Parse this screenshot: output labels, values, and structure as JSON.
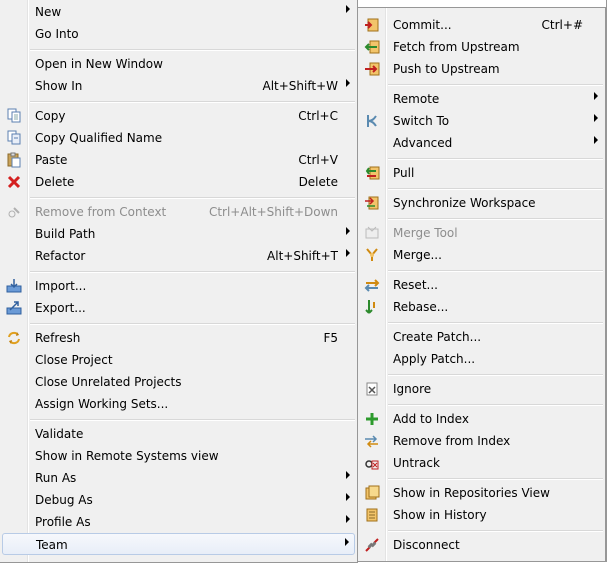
{
  "main_menu": {
    "items": [
      {
        "label": "New",
        "shortcut": "",
        "arrow": true,
        "icon": "",
        "disabled": false
      },
      {
        "label": "Go Into",
        "shortcut": "",
        "arrow": false,
        "icon": "",
        "disabled": false
      },
      {
        "label": "Open in New Window",
        "shortcut": "",
        "arrow": false,
        "icon": "",
        "disabled": false
      },
      {
        "label": "Show In",
        "shortcut": "Alt+Shift+W",
        "arrow": true,
        "icon": "",
        "disabled": false
      },
      {
        "label": "Copy",
        "shortcut": "Ctrl+C",
        "arrow": false,
        "icon": "copy-icon",
        "disabled": false
      },
      {
        "label": "Copy Qualified Name",
        "shortcut": "",
        "arrow": false,
        "icon": "copy-qualified-name-icon",
        "disabled": false
      },
      {
        "label": "Paste",
        "shortcut": "Ctrl+V",
        "arrow": false,
        "icon": "paste-icon",
        "disabled": false
      },
      {
        "label": "Delete",
        "shortcut": "Delete",
        "arrow": false,
        "icon": "delete-icon",
        "disabled": false
      },
      {
        "label": "Remove from Context",
        "shortcut": "Ctrl+Alt+Shift+Down",
        "arrow": false,
        "icon": "remove-from-context-icon",
        "disabled": true
      },
      {
        "label": "Build Path",
        "shortcut": "",
        "arrow": true,
        "icon": "",
        "disabled": false
      },
      {
        "label": "Refactor",
        "shortcut": "Alt+Shift+T",
        "arrow": true,
        "icon": "",
        "disabled": false
      },
      {
        "label": "Import...",
        "shortcut": "",
        "arrow": false,
        "icon": "import-icon",
        "disabled": false
      },
      {
        "label": "Export...",
        "shortcut": "",
        "arrow": false,
        "icon": "export-icon",
        "disabled": false
      },
      {
        "label": "Refresh",
        "shortcut": "F5",
        "arrow": false,
        "icon": "refresh-icon",
        "disabled": false
      },
      {
        "label": "Close Project",
        "shortcut": "",
        "arrow": false,
        "icon": "",
        "disabled": false
      },
      {
        "label": "Close Unrelated Projects",
        "shortcut": "",
        "arrow": false,
        "icon": "",
        "disabled": false
      },
      {
        "label": "Assign Working Sets...",
        "shortcut": "",
        "arrow": false,
        "icon": "",
        "disabled": false
      },
      {
        "label": "Validate",
        "shortcut": "",
        "arrow": false,
        "icon": "",
        "disabled": false
      },
      {
        "label": "Show in Remote Systems view",
        "shortcut": "",
        "arrow": false,
        "icon": "",
        "disabled": false
      },
      {
        "label": "Run As",
        "shortcut": "",
        "arrow": true,
        "icon": "",
        "disabled": false
      },
      {
        "label": "Debug As",
        "shortcut": "",
        "arrow": true,
        "icon": "",
        "disabled": false
      },
      {
        "label": "Profile As",
        "shortcut": "",
        "arrow": true,
        "icon": "",
        "disabled": false
      },
      {
        "label": "Team",
        "shortcut": "",
        "arrow": true,
        "icon": "",
        "disabled": false,
        "highlighted": true
      }
    ]
  },
  "team_menu": {
    "items": [
      {
        "label": "Commit...",
        "shortcut": "Ctrl+#",
        "arrow": false,
        "icon": "commit-icon",
        "disabled": false
      },
      {
        "label": "Fetch from Upstream",
        "shortcut": "",
        "arrow": false,
        "icon": "fetch-icon",
        "disabled": false
      },
      {
        "label": "Push to Upstream",
        "shortcut": "",
        "arrow": false,
        "icon": "push-icon",
        "disabled": false
      },
      {
        "label": "Remote",
        "shortcut": "",
        "arrow": true,
        "icon": "",
        "disabled": false
      },
      {
        "label": "Switch To",
        "shortcut": "",
        "arrow": true,
        "icon": "switch-branch-icon",
        "disabled": false
      },
      {
        "label": "Advanced",
        "shortcut": "",
        "arrow": true,
        "icon": "",
        "disabled": false
      },
      {
        "label": "Pull",
        "shortcut": "",
        "arrow": false,
        "icon": "pull-icon",
        "disabled": false
      },
      {
        "label": "Synchronize Workspace",
        "shortcut": "",
        "arrow": false,
        "icon": "synchronize-icon",
        "disabled": false
      },
      {
        "label": "Merge Tool",
        "shortcut": "",
        "arrow": false,
        "icon": "merge-tool-icon",
        "disabled": true
      },
      {
        "label": "Merge...",
        "shortcut": "",
        "arrow": false,
        "icon": "merge-icon",
        "disabled": false
      },
      {
        "label": "Reset...",
        "shortcut": "",
        "arrow": false,
        "icon": "reset-icon",
        "disabled": false
      },
      {
        "label": "Rebase...",
        "shortcut": "",
        "arrow": false,
        "icon": "rebase-icon",
        "disabled": false
      },
      {
        "label": "Create Patch...",
        "shortcut": "",
        "arrow": false,
        "icon": "",
        "disabled": false
      },
      {
        "label": "Apply Patch...",
        "shortcut": "",
        "arrow": false,
        "icon": "",
        "disabled": false
      },
      {
        "label": "Ignore",
        "shortcut": "",
        "arrow": false,
        "icon": "ignore-icon",
        "disabled": false
      },
      {
        "label": "Add to Index",
        "shortcut": "",
        "arrow": false,
        "icon": "add-to-index-icon",
        "disabled": false
      },
      {
        "label": "Remove from Index",
        "shortcut": "",
        "arrow": false,
        "icon": "remove-from-index-icon",
        "disabled": false
      },
      {
        "label": "Untrack",
        "shortcut": "",
        "arrow": false,
        "icon": "untrack-icon",
        "disabled": false
      },
      {
        "label": "Show in Repositories View",
        "shortcut": "",
        "arrow": false,
        "icon": "repositories-view-icon",
        "disabled": false
      },
      {
        "label": "Show in History",
        "shortcut": "",
        "arrow": false,
        "icon": "history-icon",
        "disabled": false
      },
      {
        "label": "Disconnect",
        "shortcut": "",
        "arrow": false,
        "icon": "disconnect-icon",
        "disabled": false
      }
    ]
  },
  "colors": {
    "disabled_text": "#8d8d8d",
    "highlight_border": "#b8cbe6",
    "menu_border": "#979797"
  }
}
